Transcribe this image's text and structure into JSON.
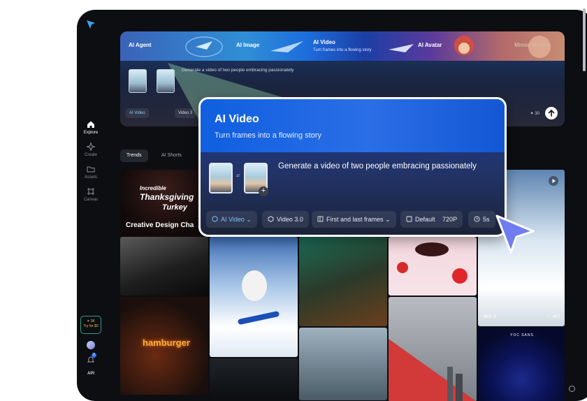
{
  "sidebar": {
    "items": [
      {
        "label": "Explore",
        "icon": "home-icon"
      },
      {
        "label": "Create",
        "icon": "sparkle-icon"
      },
      {
        "label": "Assets",
        "icon": "folder-icon"
      },
      {
        "label": "Canvas",
        "icon": "canvas-icon"
      }
    ],
    "promo_line1": "✦ 3K",
    "promo_line2": "Try for $0",
    "notification_count": "2",
    "api_label": "API"
  },
  "hero": {
    "tabs": [
      {
        "label": "AI Agent"
      },
      {
        "label": "AI Image"
      },
      {
        "label": "AI Video",
        "sub": "Turn frames into a flowing story"
      },
      {
        "label": "AI Avatar"
      },
      {
        "label": "Mimic Motion"
      }
    ],
    "prompt": "Generate a video of two people embracing passionately",
    "toolbar": {
      "mode": "AI Video",
      "model": "Video 3"
    },
    "credits": "30"
  },
  "popup": {
    "title": "AI Video",
    "subtitle": "Turn frames into a flowing story",
    "prompt": "Generate a video of two people embracing passionately",
    "chips": {
      "mode": "AI Video",
      "model": "Video 3.0",
      "frames": "First and last frames",
      "ratio": "Default",
      "resolution": "720P",
      "duration": "5s"
    }
  },
  "feed": {
    "tabs": [
      "Trends",
      "AI Shorts"
    ],
    "tiles": {
      "creative_line1": "Incredible",
      "creative_line2": "Thanksgiving",
      "creative_line3": "Turkey",
      "creative_caption": "Creative Design Cha",
      "hamburger": "hamburger",
      "author": "Wiz.X",
      "likes": "457",
      "brand": "YOC SANS"
    }
  },
  "colors": {
    "accent": "#1457d4",
    "cursor": "#6f7df0",
    "sidebar_bg": "#0d0e12"
  }
}
